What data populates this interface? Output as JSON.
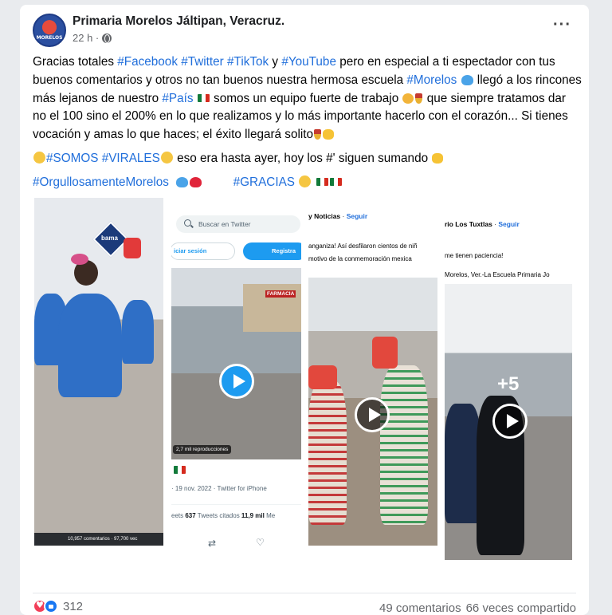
{
  "post": {
    "page_name": "Primaria Morelos Jáltipan, Veracruz.",
    "avatar_text": "MORELOS",
    "time": "22 h ·",
    "more": "···",
    "text": {
      "l1_a": "Gracias totales ",
      "tag_facebook": "#Facebook",
      "tag_twitter": "#Twitter",
      "tag_tiktok": "#TikTok",
      "l1_y": " y ",
      "tag_youtube": "#YouTube",
      "l1_b": " pero en especial a ti espectador con tus buenos comentarios y otros no tan buenos nuestra hermosa escuela ",
      "tag_morelos": "#Morelos",
      "l1_c": " llegó a los rincones más lejanos de nuestro ",
      "tag_pais": "#País",
      "l1_d": " somos un equipo fuerte de trabajo ",
      "l1_e": " que siempre tratamos dar no el 100 sino el 200% en lo que realizamos y lo más importante hacerlo con el corazón... Si tienes vocación y amas lo que haces; el éxito llegará solito",
      "tag_somos": "#SOMOS",
      "tag_virales": "#VIRALES",
      "l2": " eso era hasta ayer, hoy los #' siguen sumando ",
      "tag_orgullo": "#OrgullosamenteMorelos",
      "tag_gracias": "#GRACIAS"
    }
  },
  "gallery": {
    "p1": {
      "sign": "bama",
      "stats": "10,957 comentarios · 97,700 vec"
    },
    "p2": {
      "search_placeholder": "Buscar en Twitter",
      "login": "iciar sesión",
      "register": "Registra",
      "store": "FARMACIA",
      "views": "2,7 mil reproducciones",
      "date": "· 19 nov. 2022 · Twitter for iPhone",
      "counts_pre": "eets   ",
      "quotes_num": "637",
      "quotes_label": " Tweets citados   ",
      "likes_num": "11,9 mil",
      "likes_label": " Me"
    },
    "p3": {
      "source": "y Noticias",
      "follow": "Seguir",
      "line1": "anganiza! Así desfilaron cientos de niñ",
      "line2": "motivo de la conmemoración mexica"
    },
    "p4": {
      "source": "rio Los Tuxtlas",
      "follow": "Seguir",
      "line1": "me tienen paciencia!",
      "line2": "Morelos, Ver.-La Escuela Primaria Jo",
      "more": "+5"
    }
  },
  "footer": {
    "reaction_count": "312",
    "comments": "49 comentarios",
    "shares": "66 veces compartido"
  },
  "colors": {
    "hashtag": "#216fdb",
    "twitter_blue": "#1d9bf0",
    "love": "#f33e58",
    "like": "#1877f2"
  }
}
